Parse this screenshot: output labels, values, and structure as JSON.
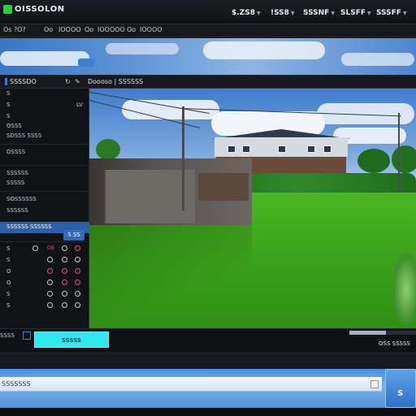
{
  "app": {
    "title": "OISSOLON"
  },
  "toolbar": {
    "buttons": [
      {
        "label": "$.ZS8",
        "has_menu": true
      },
      {
        "label": "!SS8",
        "has_menu": true
      },
      {
        "label": "SSSNF",
        "has_menu": true
      },
      {
        "label": "SLSFF",
        "has_menu": true
      },
      {
        "label": "SSSFF",
        "has_menu": true
      }
    ]
  },
  "menu": {
    "items": [
      "Os ?O?",
      "Oo",
      "IOOOO",
      "Oo",
      "IOOOOO",
      "Oo",
      "IOOOO"
    ]
  },
  "secondary": {
    "select_label": "SSSSDO",
    "icons": [
      "refresh-icon",
      "edit-icon"
    ],
    "breadcrumb": "Doooso | SSSSSS"
  },
  "left_panel": {
    "rows": [
      {
        "label": "S",
        "right": ""
      },
      {
        "label": "S",
        "right": "LV"
      },
      {
        "label": "S",
        "right": ""
      },
      {
        "label": "OSSS",
        "right": ""
      },
      {
        "label": "SDSSS SSSS",
        "right": ""
      },
      {
        "label": "DSSSS",
        "right": ""
      },
      {
        "label": "SSSSSS",
        "right": ""
      },
      {
        "label": "SSSSS",
        "right": ""
      },
      {
        "label": "SOSSSSSS",
        "right": ""
      },
      {
        "label": "SSSSSS",
        "right": ""
      }
    ],
    "selected_label": "SSSSSS SSSSSS",
    "badge": "S SS",
    "table_rows": [
      {
        "c0": "S",
        "tag": "OB",
        "dots": [
          "plain",
          "plain",
          "pink"
        ]
      },
      {
        "c0": "S",
        "tag": "",
        "dots": [
          "plain",
          "plain",
          "plain"
        ]
      },
      {
        "c0": "O",
        "tag": "",
        "dots": [
          "pink",
          "pink",
          "pink"
        ]
      },
      {
        "c0": "O",
        "tag": "",
        "dots": [
          "plain",
          "pink",
          "pink"
        ]
      },
      {
        "c0": "S",
        "tag": "",
        "dots": [
          "plain",
          "plain",
          "plain"
        ]
      },
      {
        "c0": "S",
        "tag": "",
        "dots": [
          "plain",
          "plain",
          "plain"
        ]
      }
    ]
  },
  "status": {
    "left_text": "SSSS",
    "cyan_button": "SSSSS",
    "right_text": "OSS SSSSS",
    "progress_fraction": 0.55
  },
  "bottom": {
    "input_label": "SSSSSSS",
    "thumb_label": "S"
  },
  "colors": {
    "accent": "#2f7fe0",
    "selected": "#2b5fa6",
    "cyan": "#31e7f0",
    "pink": "#e94a8e",
    "lawn": "#3da51c"
  }
}
